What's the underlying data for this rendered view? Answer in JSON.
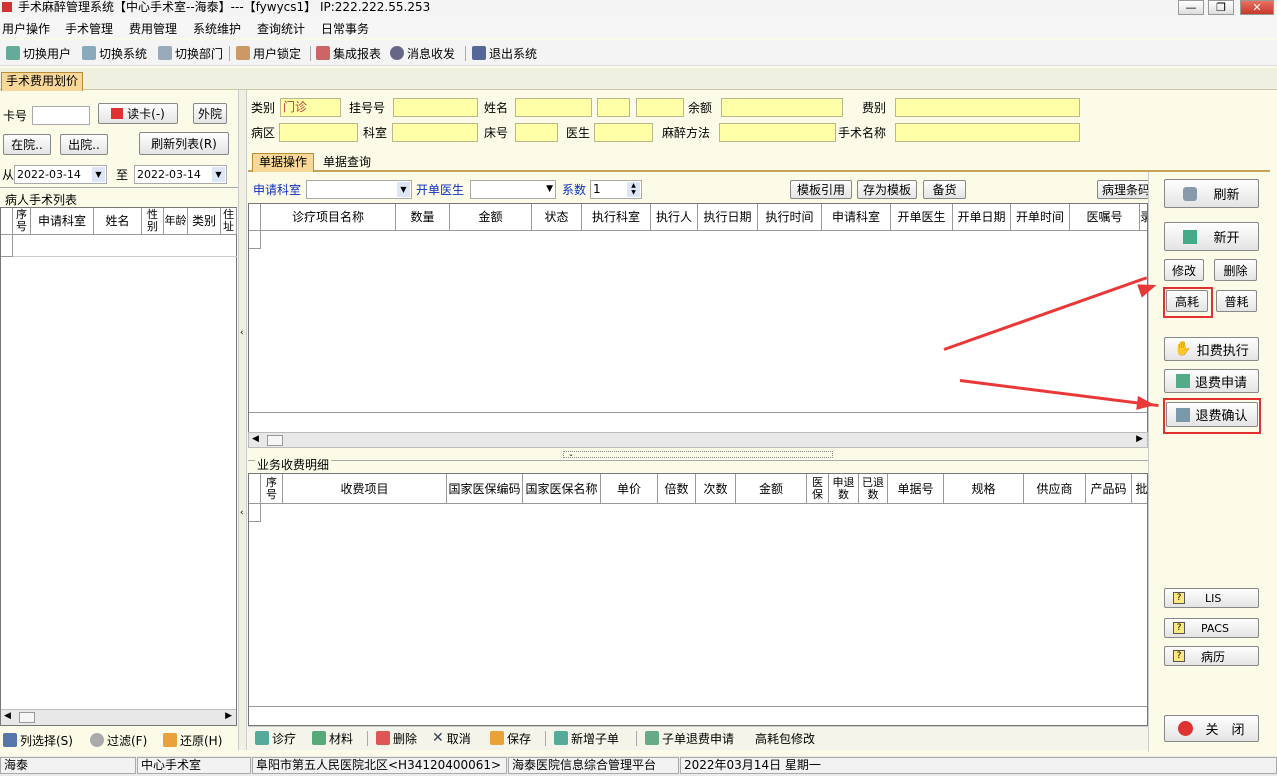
{
  "window": {
    "title": "手术麻醉管理系统【中心手术室--海泰】---【fywycs1】 IP:222.222.55.253",
    "min": "—",
    "max": "❐",
    "close": "✕"
  },
  "menu": [
    "用户操作",
    "手术管理",
    "费用管理",
    "系统维护",
    "查询统计",
    "日常事务"
  ],
  "toolbar": [
    "切换用户",
    "切换系统",
    "切换部门",
    "用户锁定",
    "集成报表",
    "消息收发",
    "退出系统"
  ],
  "main_tab": "手术费用划价",
  "left": {
    "card_label": "卡号",
    "card_value": "",
    "read_card": "读卡(-)",
    "outpatient": "外院",
    "in_hospital": "在院..",
    "discharged": "出院..",
    "refresh_list": "刷新列表(R)",
    "from_label": "从",
    "from_date": "2022-03-14",
    "to_label": "至",
    "to_date": "2022-03-14",
    "list_title": "病人手术列表",
    "cols": [
      "序号",
      "申请科室",
      "姓名",
      "性别",
      "年龄",
      "类别",
      "住址"
    ],
    "multi_select": "列选择(S)",
    "filter": "过滤(F)",
    "restore": "还原(H)"
  },
  "patient": {
    "type_label": "类别",
    "type_value": "门诊",
    "reg_label": "挂号号",
    "name_label": "姓名",
    "balance_label": "余额",
    "fee_label": "费别",
    "ward_label": "病区",
    "dept_label": "科室",
    "bed_label": "床号",
    "doctor_label": "医生",
    "anesth_label": "麻醉方法",
    "surgery_label": "手术名称"
  },
  "subtabs": [
    "单据操作",
    "单据查询"
  ],
  "ops": {
    "apply_dept": "申请科室",
    "doctor": "开单医生",
    "coef_label": "系数",
    "coef_value": "1",
    "template_ref": "模板引用",
    "save_template": "存为模板",
    "stock": "备货",
    "pathology": "病理条码"
  },
  "grid1_cols": [
    "诊疗项目名称",
    "数量",
    "金额",
    "状态",
    "执行科室",
    "执行人",
    "执行日期",
    "执行时间",
    "申请科室",
    "开单医生",
    "开单日期",
    "开单时间",
    "医嘱号",
    "录"
  ],
  "detail_title": "业务收费明细",
  "grid2_cols": [
    "序号",
    "收费项目",
    "国家医保编码",
    "国家医保名称",
    "单价",
    "倍数",
    "次数",
    "金额",
    "医保",
    "申退数",
    "已退数",
    "单据号",
    "规格",
    "供应商",
    "产品码",
    "批"
  ],
  "bottom": [
    "诊疗",
    "材料",
    "删除",
    "取消",
    "保存",
    "新增子单",
    "子单退费申请",
    "高耗包修改"
  ],
  "right": {
    "refresh": "刷新",
    "new": "新开",
    "edit": "修改",
    "delete": "删除",
    "high": "高耗",
    "normal": "普耗",
    "deduct": "扣费执行",
    "refund_apply": "退费申请",
    "refund_confirm": "退费确认",
    "lis": "LIS",
    "pacs": "PACS",
    "record": "病历",
    "close": "关　闭"
  },
  "status": [
    "海泰",
    "中心手术室",
    "阜阳市第五人民医院北区<H34120400061>",
    "海泰医院信息综合管理平台",
    "2022年03月14日 星期一"
  ],
  "colors": {
    "accent": "#f8d898",
    "highlight": "#e03030",
    "yellow": "#ffffa8"
  }
}
